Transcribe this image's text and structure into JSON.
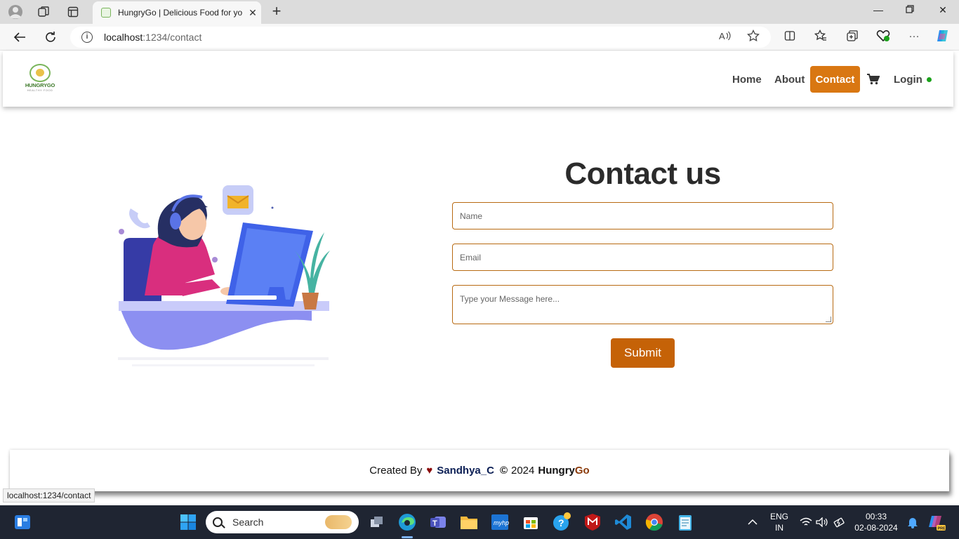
{
  "browser": {
    "tab_title": "HungryGo | Delicious Food for yo",
    "url_host": "localhost",
    "url_path": ":1234/contact",
    "status_url": "localhost:1234/contact"
  },
  "site": {
    "logo_text": "HUNGRYGO",
    "logo_tagline": "HEALTHY FOOD",
    "nav": {
      "home": "Home",
      "about": "About",
      "contact": "Contact",
      "login": "Login"
    }
  },
  "contact": {
    "heading": "Contact us",
    "name_placeholder": "Name",
    "email_placeholder": "Email",
    "message_placeholder": "Type your Message here...",
    "submit_label": "Submit"
  },
  "footer": {
    "created_by": "Created By",
    "author": "Sandhya_C",
    "year": "2024",
    "brand_part1": "Hungry",
    "brand_part2": "Go"
  },
  "taskbar": {
    "search_placeholder": "Search",
    "lang_line1": "ENG",
    "lang_line2": "IN",
    "time": "00:33",
    "date": "02-08-2024"
  },
  "colors": {
    "accent": "#d97712",
    "submit": "#c56207",
    "field_border": "#b86a12",
    "status_dot": "#1ca21c"
  }
}
